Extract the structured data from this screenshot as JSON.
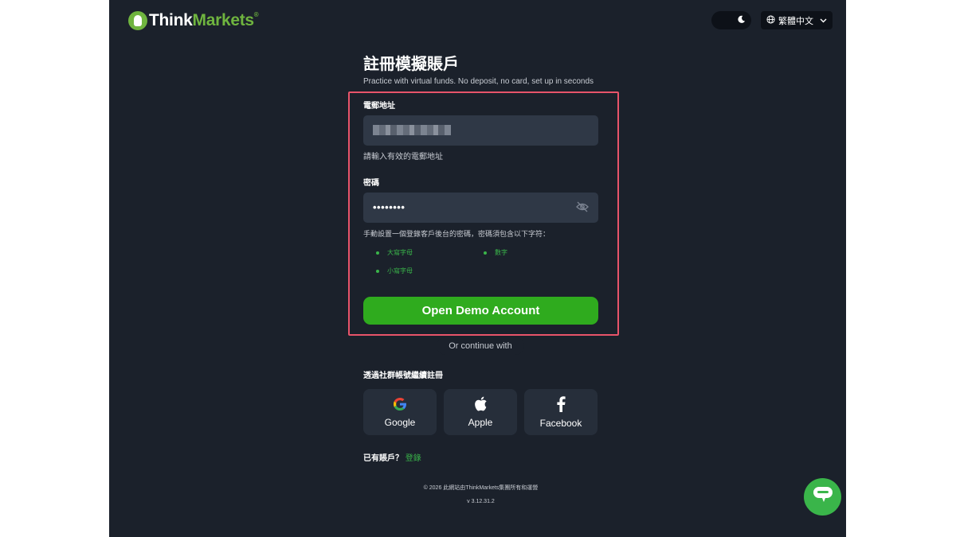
{
  "brand": {
    "think": "Think",
    "markets": "Markets",
    "reg": "®"
  },
  "header": {
    "theme_icon": "moon-icon",
    "language": "繁體中文",
    "colors": {
      "accent": "#2fab1e",
      "link": "#3ab54a",
      "highlight": "#e8546a"
    }
  },
  "page": {
    "title": "註冊模擬賬戶",
    "subtitle": "Practice with virtual funds. No deposit, no card, set up in seconds"
  },
  "form": {
    "email_label": "電郵地址",
    "email_hint": "請輸入有效的電郵地址",
    "password_label": "密碼",
    "password_value": "••••••••",
    "password_hint": "手動設置一個登錄客戶後台的密碼，密碼須包含以下字符：",
    "rules": [
      "大寫字母",
      "數字",
      "小寫字母"
    ],
    "submit_label": "Open Demo Account"
  },
  "social": {
    "divider": "Or continue with",
    "label": "透過社群帳號繼續註冊",
    "buttons": [
      {
        "label": "Google",
        "icon": "google-icon"
      },
      {
        "label": "Apple",
        "icon": "apple-icon"
      },
      {
        "label": "Facebook",
        "icon": "facebook-icon"
      }
    ]
  },
  "login": {
    "prompt": "已有賬戶？",
    "link": "登錄"
  },
  "footer": {
    "copyright": "© 2026 此網站由ThinkMarkets集團所有和運營",
    "version": "v 3.12.31.2"
  }
}
